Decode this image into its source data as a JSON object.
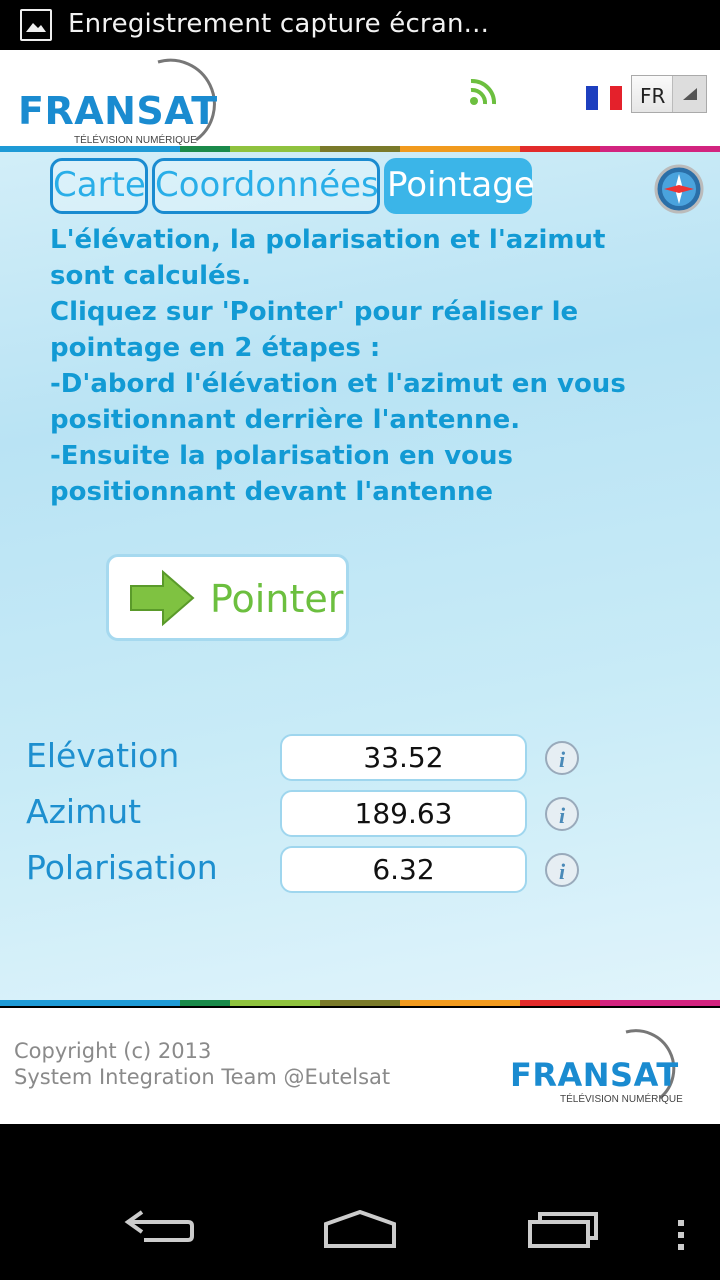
{
  "status_bar": {
    "notification": "Enregistrement capture écran..."
  },
  "header": {
    "logo_word": "FRANSAT",
    "logo_sub": "TÉLÉVISION NUMÉRIQUE",
    "language": "FR"
  },
  "tabs": [
    {
      "label": "Carte",
      "active": false
    },
    {
      "label": "Coordonnées",
      "active": false
    },
    {
      "label": "Pointage",
      "active": true
    }
  ],
  "instructions": [
    "L'élévation, la polarisation et l'azimut",
    "sont calculés.",
    "Cliquez sur 'Pointer' pour réaliser le",
    "pointage en 2 étapes :",
    "-D'abord l'élévation et l'azimut en vous",
    "positionnant derrière l'antenne.",
    "-Ensuite la polarisation en vous",
    "positionnant devant l'antenne"
  ],
  "pointer_button": {
    "label": "Pointer"
  },
  "measurements": [
    {
      "label": "Elévation",
      "value": "33.52"
    },
    {
      "label": "Azimut",
      "value": "189.63"
    },
    {
      "label": "Polarisation",
      "value": "6.32"
    }
  ],
  "footer": {
    "copyright_line1": "Copyright (c) 2013",
    "copyright_line2": "System Integration Team @Eutelsat",
    "logo_word": "FRANSAT",
    "logo_sub": "TÉLÉVISION NUMÉRIQUE"
  },
  "colors": {
    "accent": "#1a8bd0",
    "tab_active": "#3bb5e8",
    "pointer_green": "#6cbf3f",
    "stripe": [
      "#1e9ad6",
      "#1a8a4a",
      "#8fc23e",
      "#7a7a2a",
      "#f19a1e",
      "#e22b2b",
      "#d2247f"
    ]
  },
  "icons": {
    "status": "image-icon",
    "rss": "rss-icon",
    "flag": "france-flag-icon",
    "compass": "compass-icon",
    "info": "info-icon",
    "arrow": "arrow-right-icon"
  }
}
